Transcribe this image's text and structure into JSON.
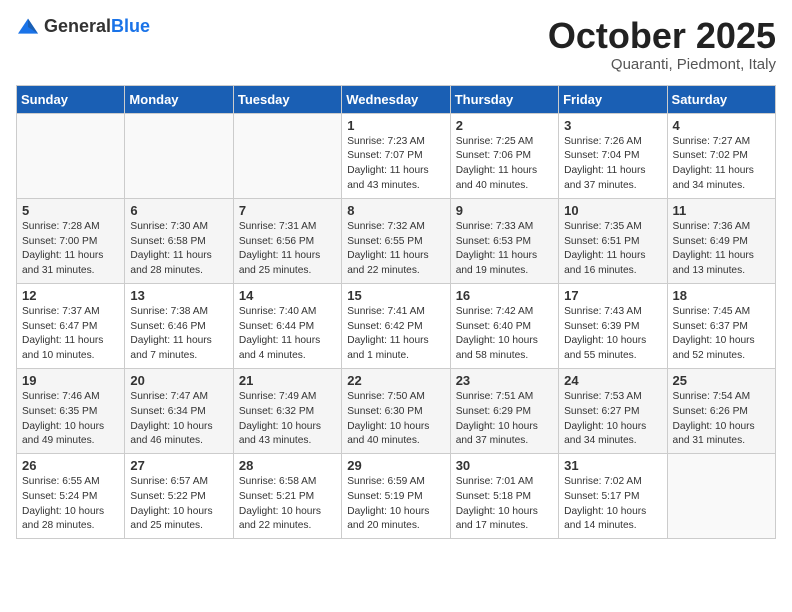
{
  "header": {
    "logo": {
      "general": "General",
      "blue": "Blue"
    },
    "title": "October 2025",
    "location": "Quaranti, Piedmont, Italy"
  },
  "calendar": {
    "days_of_week": [
      "Sunday",
      "Monday",
      "Tuesday",
      "Wednesday",
      "Thursday",
      "Friday",
      "Saturday"
    ],
    "weeks": [
      [
        {
          "day": "",
          "info": ""
        },
        {
          "day": "",
          "info": ""
        },
        {
          "day": "",
          "info": ""
        },
        {
          "day": "1",
          "info": "Sunrise: 7:23 AM\nSunset: 7:07 PM\nDaylight: 11 hours\nand 43 minutes."
        },
        {
          "day": "2",
          "info": "Sunrise: 7:25 AM\nSunset: 7:06 PM\nDaylight: 11 hours\nand 40 minutes."
        },
        {
          "day": "3",
          "info": "Sunrise: 7:26 AM\nSunset: 7:04 PM\nDaylight: 11 hours\nand 37 minutes."
        },
        {
          "day": "4",
          "info": "Sunrise: 7:27 AM\nSunset: 7:02 PM\nDaylight: 11 hours\nand 34 minutes."
        }
      ],
      [
        {
          "day": "5",
          "info": "Sunrise: 7:28 AM\nSunset: 7:00 PM\nDaylight: 11 hours\nand 31 minutes."
        },
        {
          "day": "6",
          "info": "Sunrise: 7:30 AM\nSunset: 6:58 PM\nDaylight: 11 hours\nand 28 minutes."
        },
        {
          "day": "7",
          "info": "Sunrise: 7:31 AM\nSunset: 6:56 PM\nDaylight: 11 hours\nand 25 minutes."
        },
        {
          "day": "8",
          "info": "Sunrise: 7:32 AM\nSunset: 6:55 PM\nDaylight: 11 hours\nand 22 minutes."
        },
        {
          "day": "9",
          "info": "Sunrise: 7:33 AM\nSunset: 6:53 PM\nDaylight: 11 hours\nand 19 minutes."
        },
        {
          "day": "10",
          "info": "Sunrise: 7:35 AM\nSunset: 6:51 PM\nDaylight: 11 hours\nand 16 minutes."
        },
        {
          "day": "11",
          "info": "Sunrise: 7:36 AM\nSunset: 6:49 PM\nDaylight: 11 hours\nand 13 minutes."
        }
      ],
      [
        {
          "day": "12",
          "info": "Sunrise: 7:37 AM\nSunset: 6:47 PM\nDaylight: 11 hours\nand 10 minutes."
        },
        {
          "day": "13",
          "info": "Sunrise: 7:38 AM\nSunset: 6:46 PM\nDaylight: 11 hours\nand 7 minutes."
        },
        {
          "day": "14",
          "info": "Sunrise: 7:40 AM\nSunset: 6:44 PM\nDaylight: 11 hours\nand 4 minutes."
        },
        {
          "day": "15",
          "info": "Sunrise: 7:41 AM\nSunset: 6:42 PM\nDaylight: 11 hours\nand 1 minute."
        },
        {
          "day": "16",
          "info": "Sunrise: 7:42 AM\nSunset: 6:40 PM\nDaylight: 10 hours\nand 58 minutes."
        },
        {
          "day": "17",
          "info": "Sunrise: 7:43 AM\nSunset: 6:39 PM\nDaylight: 10 hours\nand 55 minutes."
        },
        {
          "day": "18",
          "info": "Sunrise: 7:45 AM\nSunset: 6:37 PM\nDaylight: 10 hours\nand 52 minutes."
        }
      ],
      [
        {
          "day": "19",
          "info": "Sunrise: 7:46 AM\nSunset: 6:35 PM\nDaylight: 10 hours\nand 49 minutes."
        },
        {
          "day": "20",
          "info": "Sunrise: 7:47 AM\nSunset: 6:34 PM\nDaylight: 10 hours\nand 46 minutes."
        },
        {
          "day": "21",
          "info": "Sunrise: 7:49 AM\nSunset: 6:32 PM\nDaylight: 10 hours\nand 43 minutes."
        },
        {
          "day": "22",
          "info": "Sunrise: 7:50 AM\nSunset: 6:30 PM\nDaylight: 10 hours\nand 40 minutes."
        },
        {
          "day": "23",
          "info": "Sunrise: 7:51 AM\nSunset: 6:29 PM\nDaylight: 10 hours\nand 37 minutes."
        },
        {
          "day": "24",
          "info": "Sunrise: 7:53 AM\nSunset: 6:27 PM\nDaylight: 10 hours\nand 34 minutes."
        },
        {
          "day": "25",
          "info": "Sunrise: 7:54 AM\nSunset: 6:26 PM\nDaylight: 10 hours\nand 31 minutes."
        }
      ],
      [
        {
          "day": "26",
          "info": "Sunrise: 6:55 AM\nSunset: 5:24 PM\nDaylight: 10 hours\nand 28 minutes."
        },
        {
          "day": "27",
          "info": "Sunrise: 6:57 AM\nSunset: 5:22 PM\nDaylight: 10 hours\nand 25 minutes."
        },
        {
          "day": "28",
          "info": "Sunrise: 6:58 AM\nSunset: 5:21 PM\nDaylight: 10 hours\nand 22 minutes."
        },
        {
          "day": "29",
          "info": "Sunrise: 6:59 AM\nSunset: 5:19 PM\nDaylight: 10 hours\nand 20 minutes."
        },
        {
          "day": "30",
          "info": "Sunrise: 7:01 AM\nSunset: 5:18 PM\nDaylight: 10 hours\nand 17 minutes."
        },
        {
          "day": "31",
          "info": "Sunrise: 7:02 AM\nSunset: 5:17 PM\nDaylight: 10 hours\nand 14 minutes."
        },
        {
          "day": "",
          "info": ""
        }
      ]
    ]
  }
}
